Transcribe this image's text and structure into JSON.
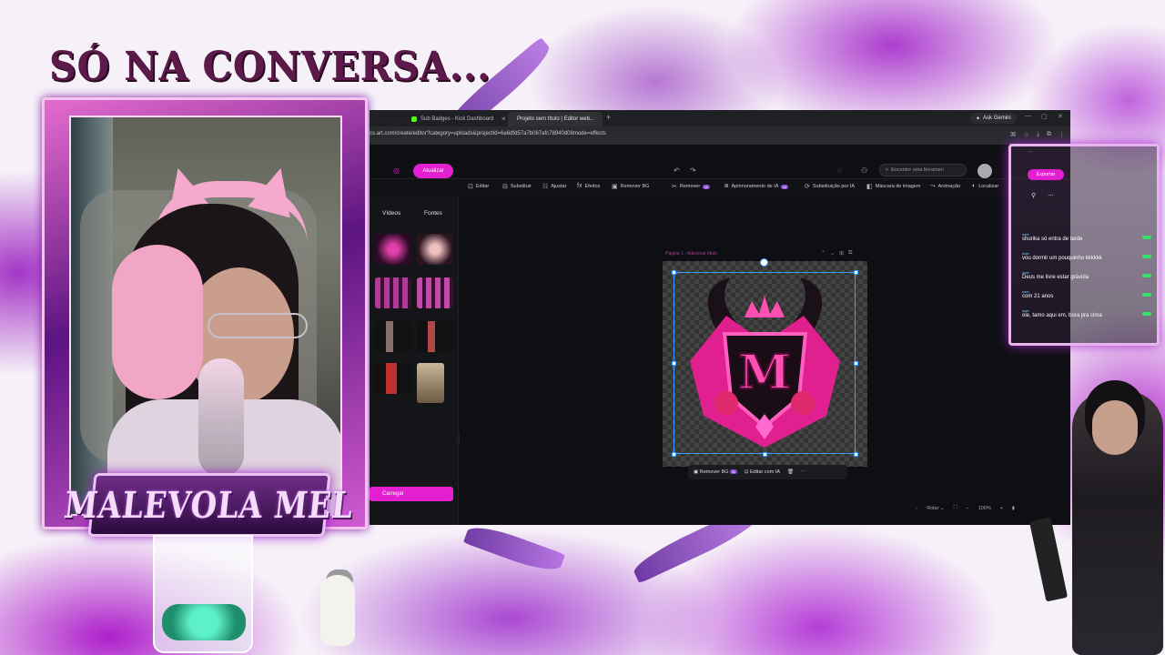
{
  "overlay": {
    "title": "SÓ NA CONVERSA...",
    "streamer_logo": "MALEVOLA MEL"
  },
  "browser": {
    "tabs": [
      {
        "label": "Sub Badges - Kick Dashboard",
        "favicon_color": "#53fc18"
      },
      {
        "label": "Projeto sem título | Editor web...",
        "favicon_color": "#e21fd1"
      }
    ],
    "ask_gemini": "Ask Gemini",
    "url": "cs.art.com/create/editor?category=uploads&projectId=6a6dfd57a7b067afc78940d08mode=effects"
  },
  "editor": {
    "upgrade_label": "Atualizar",
    "export_label": "Exportar",
    "search_placeholder": "Encontre uma ferramen",
    "toolbar": {
      "edit": "Editar",
      "replace": "Substituir",
      "adjust": "Ajustar",
      "effects": "Efeitos",
      "remove_bg": "Remover BG",
      "remove": "Remover",
      "ai_enhance": "Aprimoramento de IA",
      "ai_replace": "Substituição por IA",
      "image_mask": "Máscara de imagem",
      "animation": "Animação",
      "locate": "Localizar"
    },
    "left_panel": {
      "tab_videos": "Vídeos",
      "tab_fonts": "Fontes",
      "upload_label": "Carregar"
    },
    "canvas": {
      "page_label": "Página 1 - Adicionar título",
      "remove_bg": "Remover BG",
      "edit_ai": "Editar com IA",
      "fit_label": "Rolar",
      "zoom": "100%"
    }
  },
  "chat": {
    "messages": [
      {
        "user": "user",
        "text": "shurika só entra de tarde"
      },
      {
        "user": "user",
        "text": "vou dormir um pouquinho kkkkkk"
      },
      {
        "user": "user",
        "text": "Deus me livre estar grávida"
      },
      {
        "user": "user",
        "text": "com 21 anos"
      },
      {
        "user": "user",
        "text": "oie, tamo aqui em, bora pra cima"
      }
    ]
  },
  "colors": {
    "accent": "#e21fd1",
    "selection": "#3aa0ff",
    "overlay_purple": "#a020c8"
  }
}
